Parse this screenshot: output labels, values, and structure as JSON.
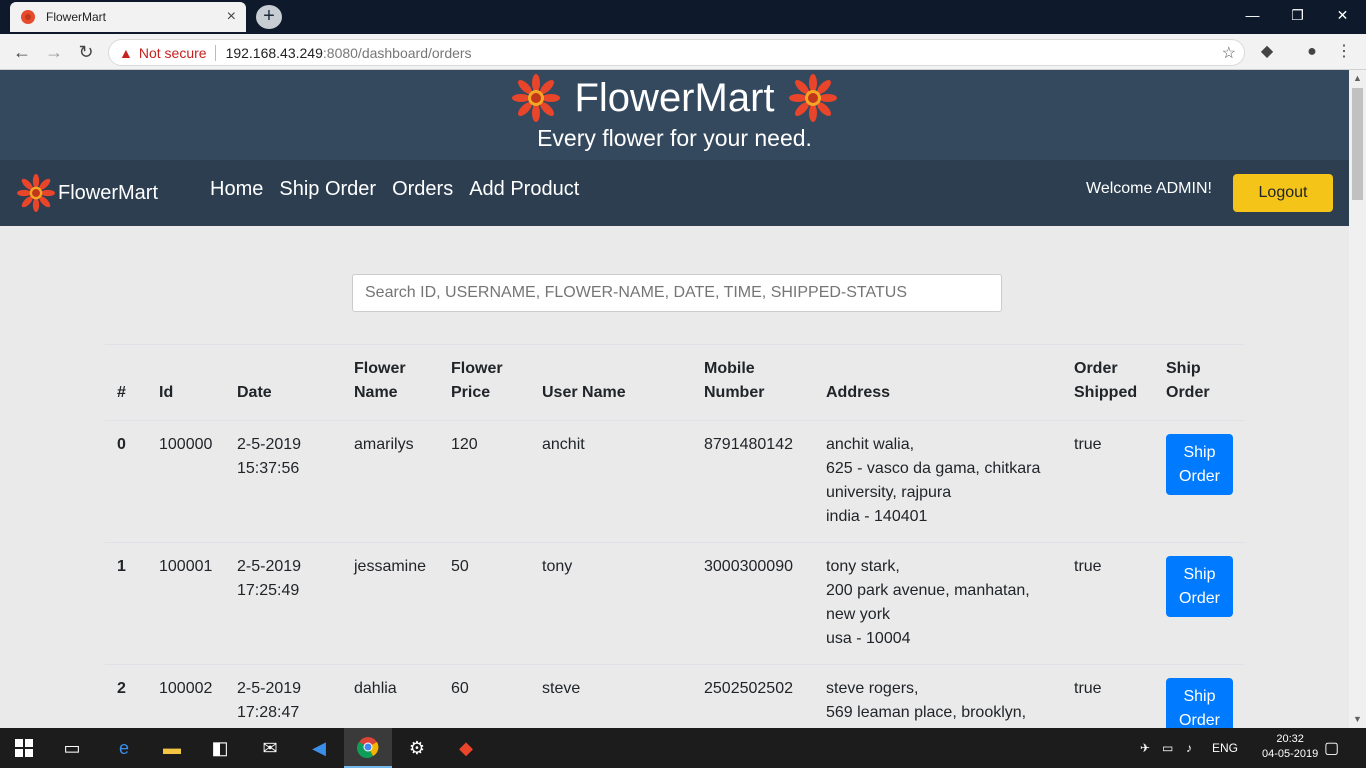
{
  "browser": {
    "tab_title": "FlowerMart",
    "tab_close": "×",
    "new_tab": "+",
    "not_secure": "Not secure",
    "url_host": "192.168.43.249",
    "url_rest": ":8080/dashboard/orders"
  },
  "hero": {
    "title": "FlowerMart",
    "subtitle": "Every flower for your need."
  },
  "nav": {
    "brand": "FlowerMart",
    "links": [
      "Home",
      "Ship Order",
      "Orders",
      "Add Product"
    ],
    "welcome": "Welcome ADMIN!",
    "logout": "Logout"
  },
  "search": {
    "placeholder": "Search ID, USERNAME, FLOWER-NAME, DATE, TIME, SHIPPED-STATUS"
  },
  "table": {
    "headers": [
      "#",
      "Id",
      "Date",
      "Flower Name",
      "Flower Price",
      "User Name",
      "Mobile Number",
      "Address",
      "Order Shipped",
      "Ship Order"
    ],
    "rows": [
      {
        "index": "0",
        "id": "100000",
        "date": "2-5-2019",
        "time": "15:37:56",
        "flower": "amarilys",
        "price": "120",
        "user": "anchit",
        "mobile": "8791480142",
        "address": [
          "anchit walia,",
          "625 - vasco da gama, chitkara university, rajpura",
          "india - 140401"
        ],
        "shipped": "true",
        "action": "Ship Order"
      },
      {
        "index": "1",
        "id": "100001",
        "date": "2-5-2019",
        "time": "17:25:49",
        "flower": "jessamine",
        "price": "50",
        "user": "tony",
        "mobile": "3000300090",
        "address": [
          "tony stark,",
          "200 park avenue, manhatan, new york",
          "usa - 10004"
        ],
        "shipped": "true",
        "action": "Ship Order"
      },
      {
        "index": "2",
        "id": "100002",
        "date": "2-5-2019",
        "time": "17:28:47",
        "flower": "dahlia",
        "price": "60",
        "user": "steve",
        "mobile": "2502502502",
        "address": [
          "steve rogers,",
          "569 leaman place, brooklyn,"
        ],
        "shipped": "true",
        "action": "Ship Order"
      }
    ]
  },
  "taskbar": {
    "lang": "ENG",
    "time": "20:32",
    "date": "04-05-2019"
  },
  "colors": {
    "hero_bg": "#34495e",
    "nav_bg": "#2c3e50",
    "logout_bg": "#f4c518",
    "ship_btn_bg": "#007bff",
    "page_bg": "#eaeaea"
  }
}
